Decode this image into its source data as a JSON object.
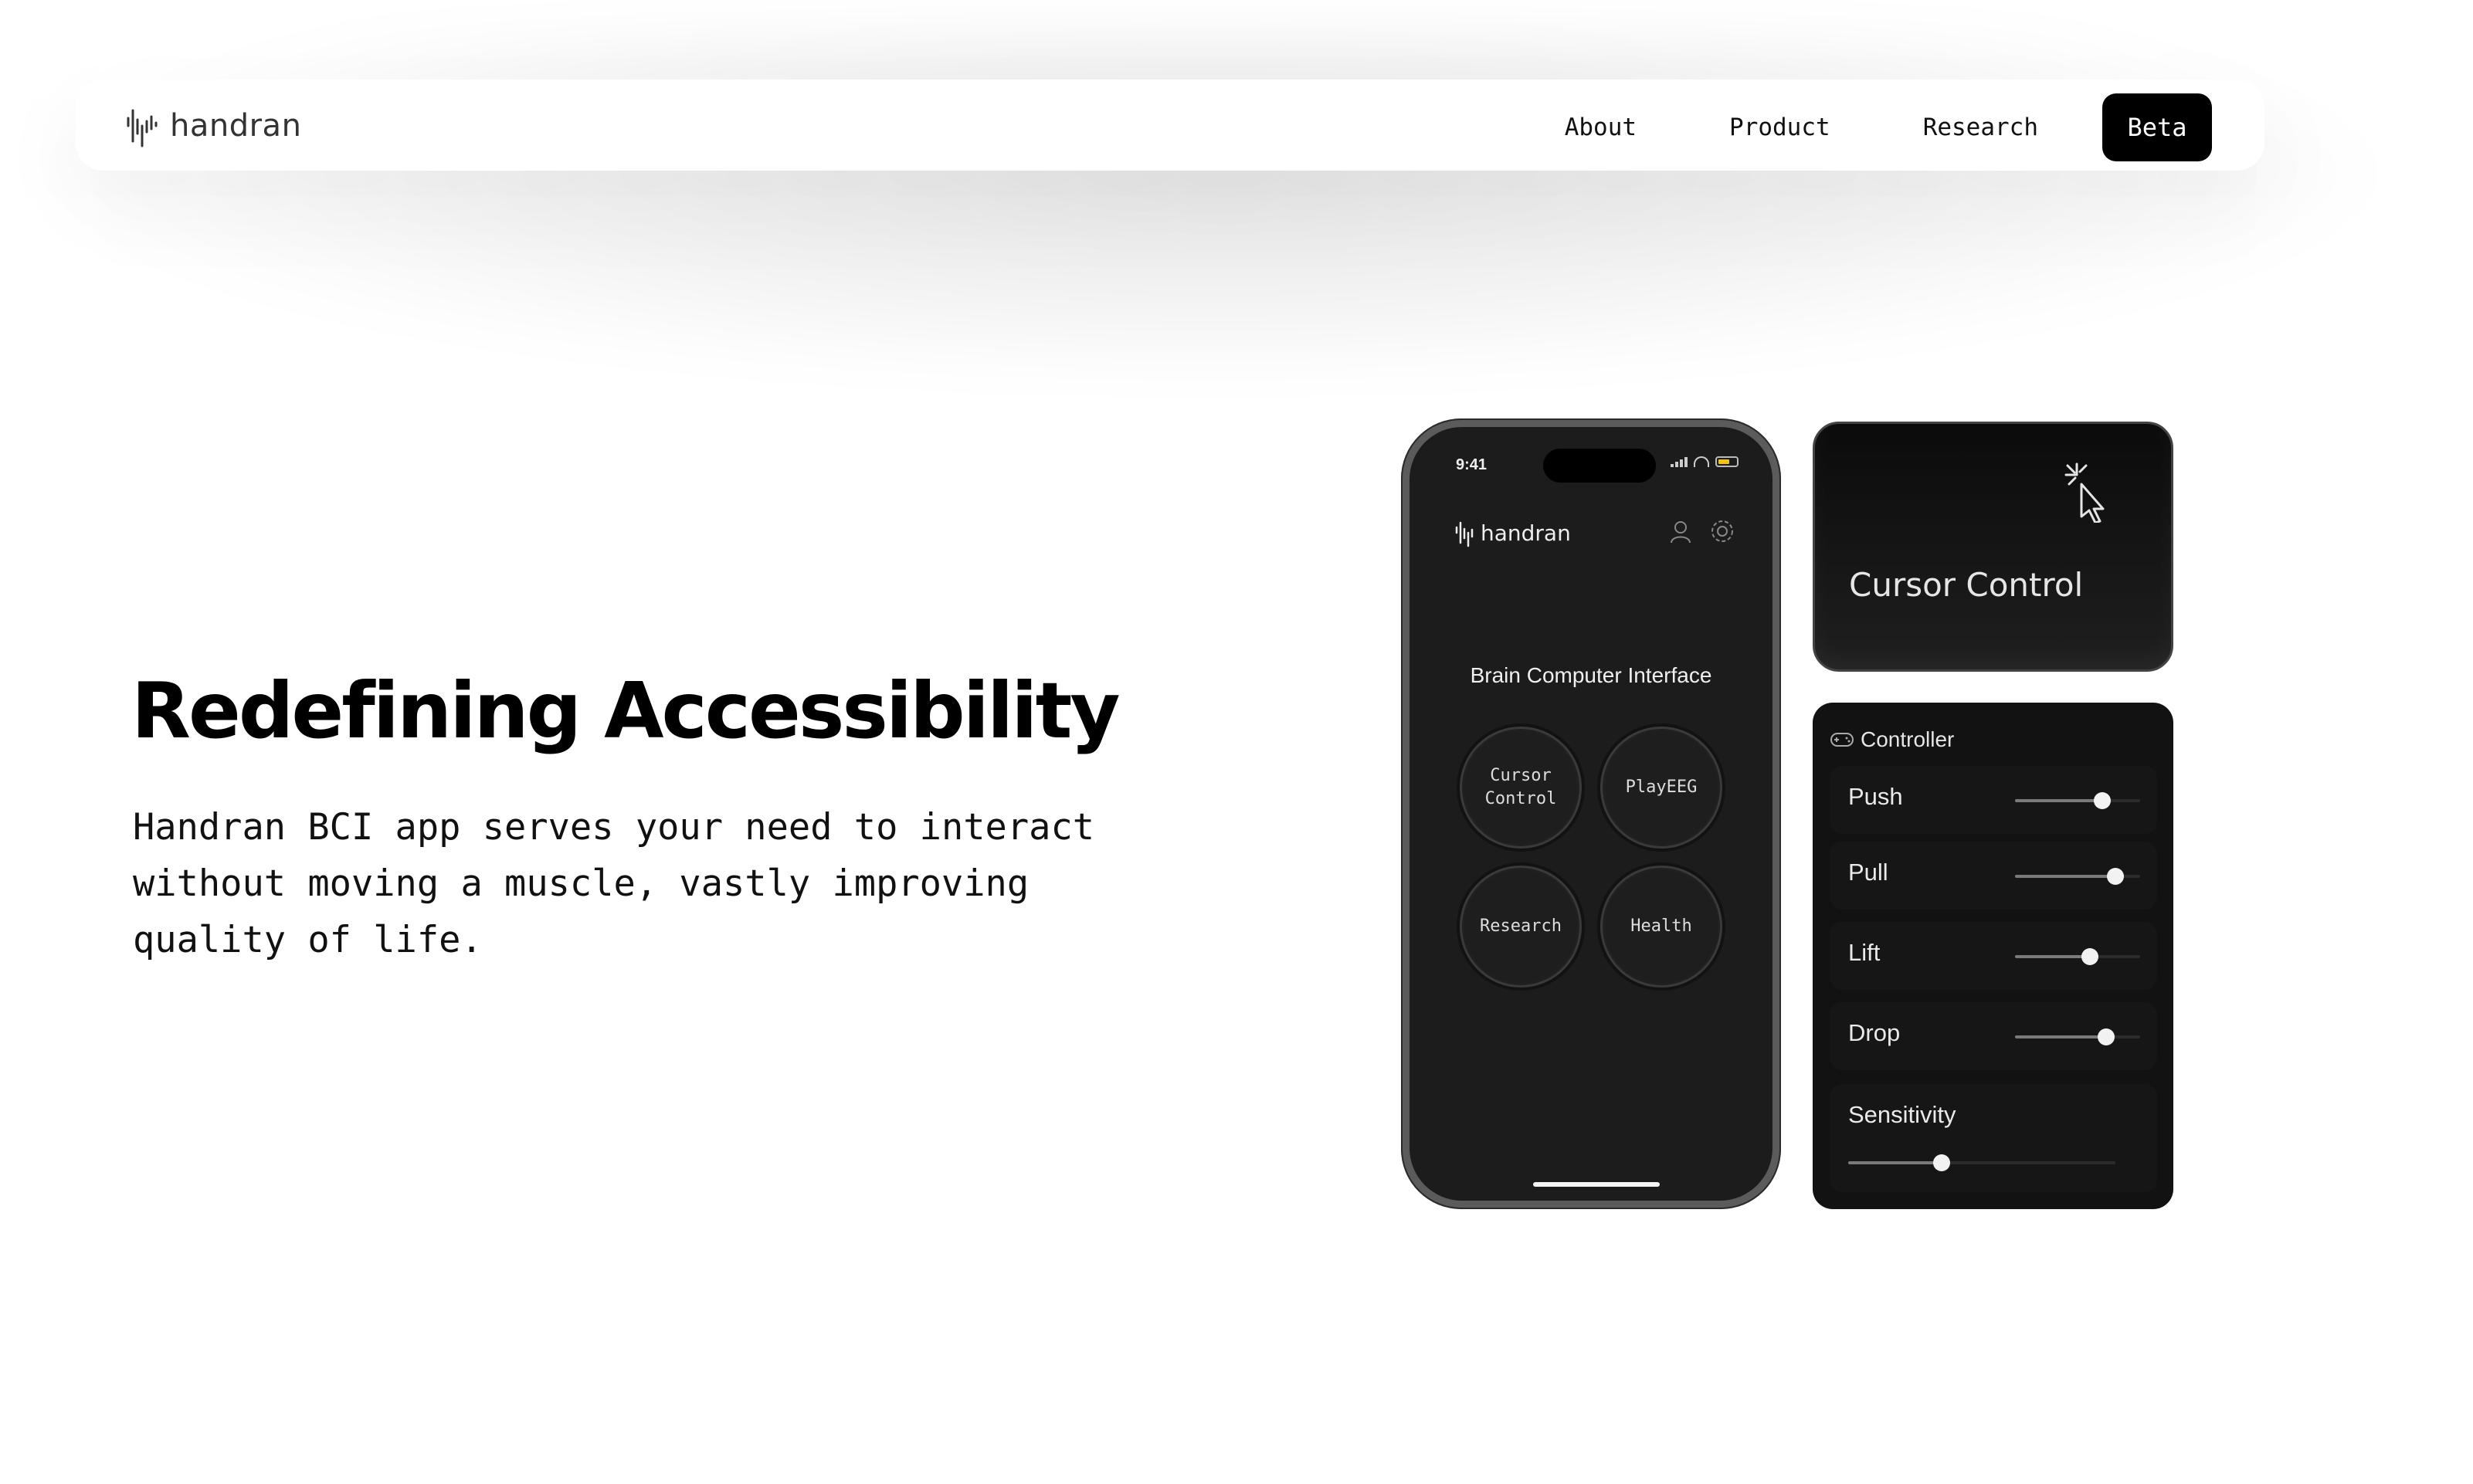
{
  "nav": {
    "brand": "handran",
    "links": [
      "About",
      "Product",
      "Research"
    ],
    "cta": "Beta"
  },
  "hero": {
    "title": "Redefining Accessibility",
    "description": "Handran BCI app serves your need to interact without moving a muscle, vastly improving quality of life."
  },
  "phone": {
    "time": "9:41",
    "brand": "handran",
    "heading": "Brain Computer Interface",
    "tiles": [
      "Cursor Control",
      "PlayEEG",
      "Research",
      "Health"
    ],
    "icons": [
      "user-icon",
      "gear-icon"
    ]
  },
  "cursor_card": {
    "title": "Cursor Control",
    "icon": "cursor-click-icon"
  },
  "controller": {
    "title": "Controller",
    "icon": "gamepad-icon",
    "sliders": [
      {
        "label": "Push",
        "value": 0.7
      },
      {
        "label": "Pull",
        "value": 0.8
      },
      {
        "label": "Lift",
        "value": 0.6
      },
      {
        "label": "Drop",
        "value": 0.73
      }
    ],
    "sensitivity": {
      "label": "Sensitivity",
      "value": 0.35
    }
  }
}
